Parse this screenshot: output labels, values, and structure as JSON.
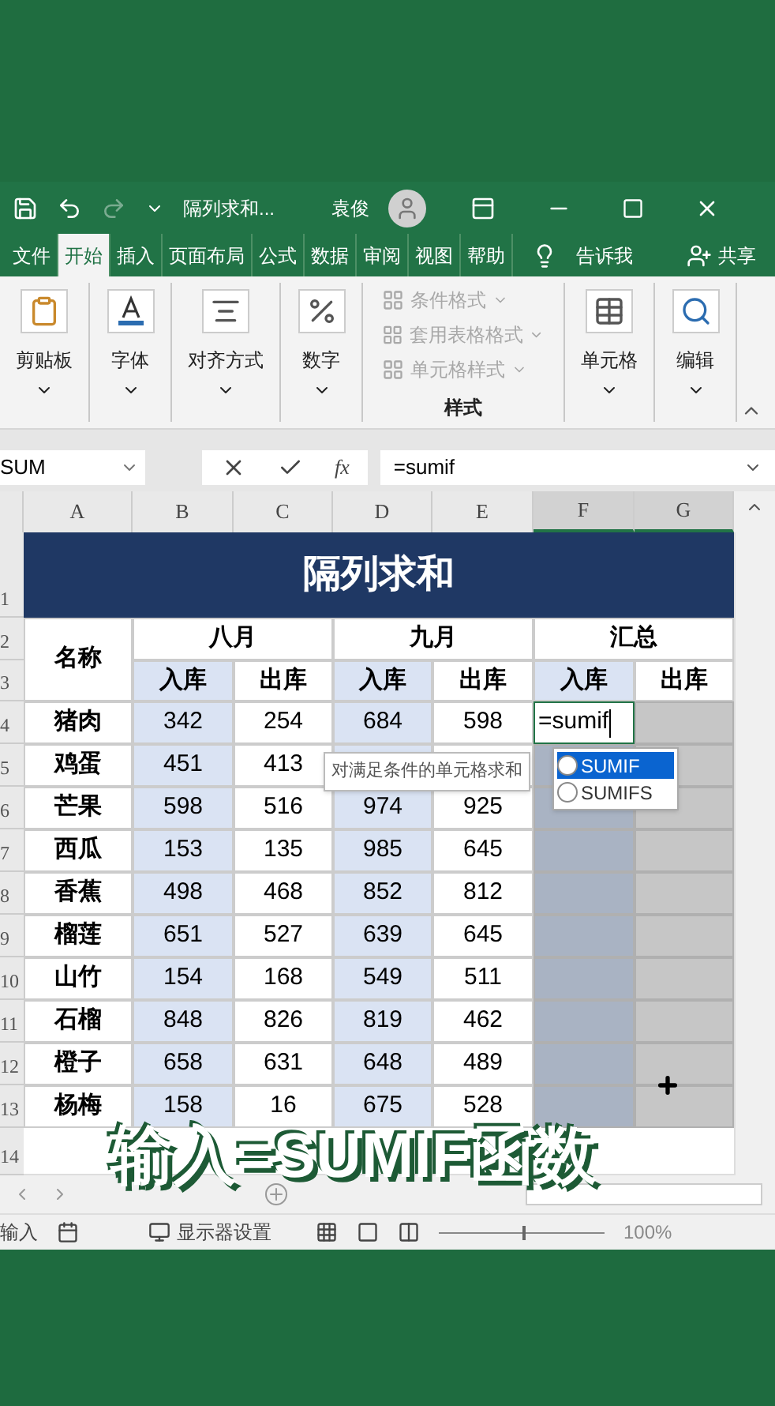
{
  "title_bar": {
    "document_title": "隔列求和...",
    "user_name": "袁俊",
    "redo_disabled": true
  },
  "ribbon_tabs": [
    {
      "label": "文件",
      "selected": false
    },
    {
      "label": "开始",
      "selected": true
    },
    {
      "label": "插入",
      "selected": false
    },
    {
      "label": "页面布局",
      "selected": false
    },
    {
      "label": "公式",
      "selected": false
    },
    {
      "label": "数据",
      "selected": false
    },
    {
      "label": "审阅",
      "selected": false
    },
    {
      "label": "视图",
      "selected": false
    },
    {
      "label": "帮助",
      "selected": false
    }
  ],
  "tell_me": "告诉我",
  "share": "共享",
  "ribbon_groups": [
    {
      "kind": "big",
      "label": "剪贴板"
    },
    {
      "kind": "big",
      "label": "字体"
    },
    {
      "kind": "big",
      "label": "对齐方式"
    },
    {
      "kind": "big",
      "label": "数字"
    },
    {
      "kind": "styles",
      "label": "样式",
      "items": [
        {
          "label": "条件格式",
          "disabled": true
        },
        {
          "label": "套用表格格式",
          "disabled": true
        },
        {
          "label": "单元格样式",
          "disabled": true
        }
      ]
    },
    {
      "kind": "big",
      "label": "单元格"
    },
    {
      "kind": "big",
      "label": "编辑"
    }
  ],
  "formula_bar": {
    "name_box": "SUM",
    "fx": "fx",
    "formula": "=sumif"
  },
  "column_headers": [
    {
      "label": "A",
      "selected": false
    },
    {
      "label": "B",
      "selected": false
    },
    {
      "label": "C",
      "selected": false
    },
    {
      "label": "D",
      "selected": false
    },
    {
      "label": "E",
      "selected": false
    },
    {
      "label": "F",
      "selected": true
    },
    {
      "label": "G",
      "selected": true
    }
  ],
  "row_numbers": [
    "1",
    "2",
    "3",
    "4",
    "5",
    "6",
    "7",
    "8",
    "9",
    "10",
    "11",
    "12",
    "13",
    "14"
  ],
  "sheet": {
    "title": "隔列求和",
    "name_header": "名称",
    "months": [
      "八月",
      "九月",
      "汇总"
    ],
    "sub_headers": [
      "入库",
      "出库",
      "入库",
      "出库",
      "入库",
      "出库"
    ],
    "summary_selected": true,
    "editing_value": "=sumif",
    "rows": [
      {
        "name": "猪肉",
        "values": [
          "342",
          "254",
          "684",
          "598"
        ]
      },
      {
        "name": "鸡蛋",
        "values": [
          "451",
          "413"
        ]
      },
      {
        "name": "芒果",
        "values": [
          "598",
          "516",
          "974",
          "925"
        ]
      },
      {
        "name": "西瓜",
        "values": [
          "153",
          "135",
          "985",
          "645"
        ]
      },
      {
        "name": "香蕉",
        "values": [
          "498",
          "468",
          "852",
          "812"
        ]
      },
      {
        "name": "榴莲",
        "values": [
          "651",
          "527",
          "639",
          "645"
        ]
      },
      {
        "name": "山竹",
        "values": [
          "154",
          "168",
          "549",
          "511"
        ]
      },
      {
        "name": "石榴",
        "values": [
          "848",
          "826",
          "819",
          "462"
        ]
      },
      {
        "name": "橙子",
        "values": [
          "658",
          "631",
          "648",
          "489"
        ]
      },
      {
        "name": "杨梅",
        "values": [
          "158",
          "16",
          "675",
          "528"
        ]
      }
    ]
  },
  "tooltip": "对满足条件的单元格求和",
  "autocomplete": [
    {
      "label": "SUMIF",
      "selected": true
    },
    {
      "label": "SUMIFS",
      "selected": false
    }
  ],
  "caption": "输入=SUMIF函数",
  "status_bar": {
    "mode": "输入",
    "display_settings": "显示器设置",
    "zoom": "100%",
    "zoom_slider": {
      "level": 0.5
    }
  }
}
